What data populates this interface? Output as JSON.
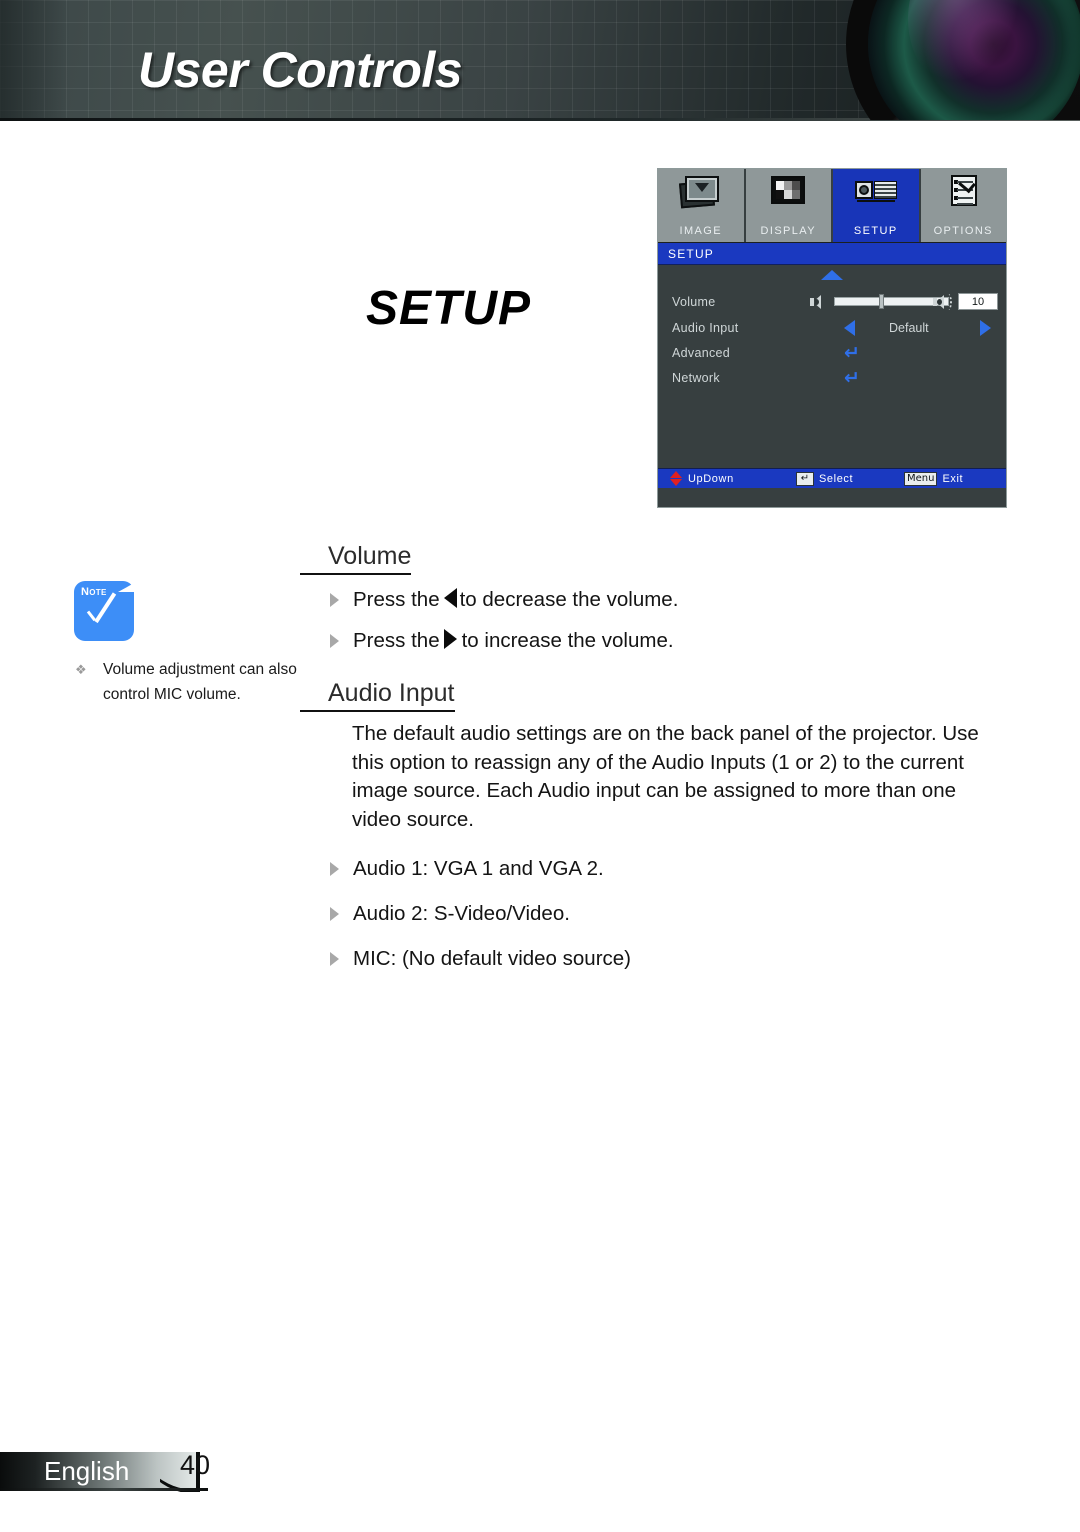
{
  "header": {
    "title": "User Controls",
    "lens_icon": "camera-lens-graphic"
  },
  "section_label": "SETUP",
  "osd": {
    "tabs": [
      {
        "label": "IMAGE",
        "icon": "image-icon",
        "active": false
      },
      {
        "label": "DISPLAY",
        "icon": "display-icon",
        "active": false
      },
      {
        "label": "SETUP",
        "icon": "projector-icon",
        "active": true
      },
      {
        "label": "OPTIONS",
        "icon": "options-checklist-icon",
        "active": false
      }
    ],
    "titlebar": "SETUP",
    "scroll_up_icon": "scroll-up-arrow-icon",
    "rows": [
      {
        "label": "Volume",
        "control": "slider",
        "value": "10"
      },
      {
        "label": "Audio Input",
        "control": "arrows",
        "value": "Default"
      },
      {
        "label": "Advanced",
        "control": "enter"
      },
      {
        "label": "Network",
        "control": "enter"
      }
    ],
    "footer": [
      {
        "icon": "up-down-arrows-icon",
        "label": "UpDown"
      },
      {
        "icon": "enter-key-icon",
        "key": "↵",
        "label": "Select"
      },
      {
        "icon": "menu-key-icon",
        "key": "Menu",
        "label": "Exit"
      }
    ],
    "colors": {
      "panel_bg": "#373f40",
      "tab_bg": "#8f9899",
      "tab_active_bg": "#1835b8",
      "titlebar_bg": "#1a39c0",
      "accent_blue": "#2f6fe8",
      "text": "#cfd6d7"
    }
  },
  "note": {
    "badge_label": "Note",
    "badge_icon": "note-check-icon",
    "bullet_glyph": "❖",
    "text": "Volume adjustment can also control MIC volume."
  },
  "content": {
    "volume": {
      "heading": "Volume",
      "bullets": [
        {
          "before": "Press the",
          "glyph": "left-triangle",
          "after": "to decrease the volume."
        },
        {
          "before": "Press the",
          "glyph": "right-triangle",
          "after": "to increase the volume."
        }
      ]
    },
    "audio_input": {
      "heading": "Audio Input",
      "paragraph": "The default audio settings are on the back panel of the projector. Use this option to reassign any of the Audio Inputs (1 or 2) to the current image source. Each Audio input can be assigned to more than one video source.",
      "bullets": [
        "Audio 1: VGA 1 and VGA 2.",
        "Audio 2: S-Video/Video.",
        "MIC: (No default video source)"
      ]
    }
  },
  "footer": {
    "language": "English",
    "page_number": "40"
  }
}
